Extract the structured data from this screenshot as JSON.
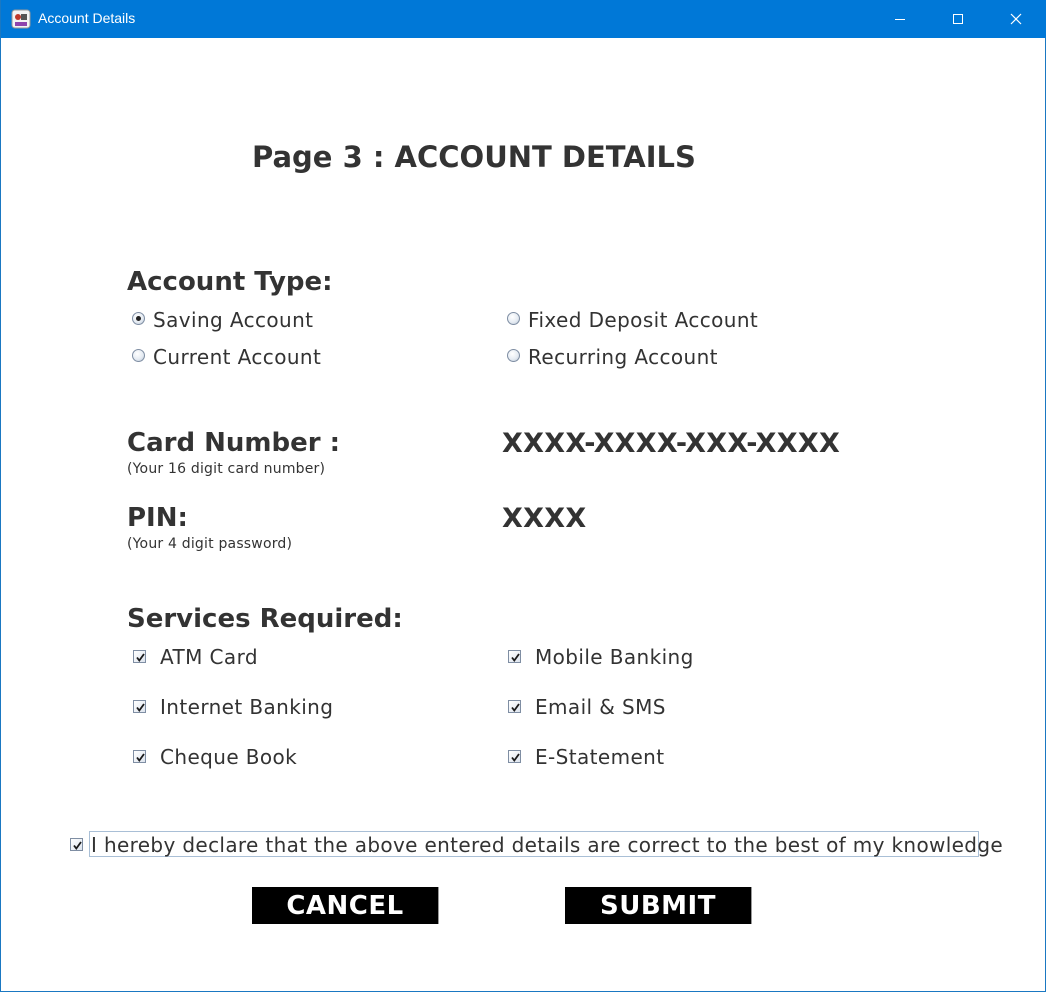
{
  "window": {
    "title": "Account Details",
    "titlebar_color": "#0078d7"
  },
  "page": {
    "title": "Page 3 : ACCOUNT DETAILS"
  },
  "account_type": {
    "heading": "Account Type:",
    "options": [
      {
        "label": "Saving Account",
        "selected": true
      },
      {
        "label": "Fixed Deposit Account",
        "selected": false
      },
      {
        "label": "Current Account",
        "selected": false
      },
      {
        "label": "Recurring Account",
        "selected": false
      }
    ]
  },
  "card": {
    "label": "Card Number :",
    "hint": "(Your 16 digit card number)",
    "value": "XXXX-XXXX-XXX-XXXX"
  },
  "pin": {
    "label": "PIN:",
    "hint": "(Your 4 digit password)",
    "value": "XXXX"
  },
  "services": {
    "heading": "Services Required:",
    "items": [
      {
        "label": "ATM Card",
        "checked": true
      },
      {
        "label": "Mobile Banking",
        "checked": true
      },
      {
        "label": "Internet Banking",
        "checked": true
      },
      {
        "label": "Email & SMS",
        "checked": true
      },
      {
        "label": "Cheque Book",
        "checked": true
      },
      {
        "label": "E-Statement",
        "checked": true
      }
    ]
  },
  "declaration": {
    "text": "I hereby declare that the above entered details are correct to the best of my knowledge",
    "checked": true
  },
  "buttons": {
    "cancel": "CANCEL",
    "submit": "SUBMIT"
  },
  "icons": {
    "app": "app-icon",
    "minimize": "minimize-icon",
    "maximize": "maximize-icon",
    "close": "close-icon"
  }
}
